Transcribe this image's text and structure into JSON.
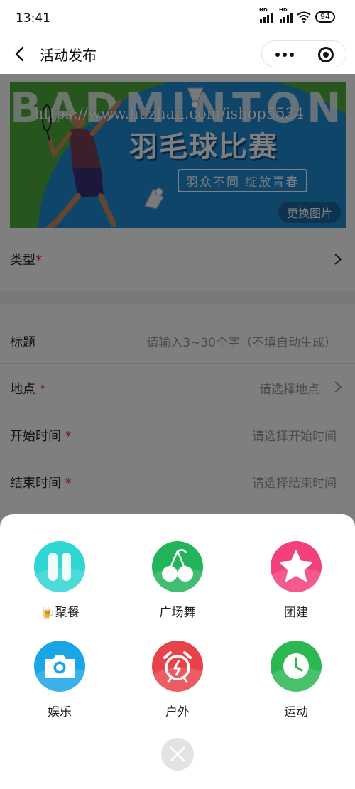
{
  "status_bar": {
    "time": "13:41",
    "battery": "94",
    "hd": "HD"
  },
  "nav": {
    "title": "活动发布"
  },
  "banner": {
    "bg_text": "BADMINTON",
    "url": "https://www.huzhan.com/ishop5534",
    "main_title": "羽毛球比赛",
    "subtitle": "羽众不同 绽放青春",
    "change_label": "更换图片"
  },
  "form": {
    "type_label": "类型",
    "required_mark": "*",
    "fields": [
      {
        "label": "标题",
        "placeholder": "请输入3~30个字（不填自动生成）",
        "required": false
      },
      {
        "label": "地点",
        "placeholder": "请选择地点",
        "required": true
      },
      {
        "label": "开始时间",
        "placeholder": "请选择开始时间",
        "required": true
      },
      {
        "label": "结束时间",
        "placeholder": "请选择结束时间",
        "required": true
      }
    ]
  },
  "categories": [
    {
      "label": "🍺聚餐",
      "icon": "pause-icon",
      "color": "#2fd6d3"
    },
    {
      "label": "广场舞",
      "icon": "cherry-icon",
      "color": "#22b45a"
    },
    {
      "label": "团建",
      "icon": "star-icon",
      "color": "#f2417a"
    },
    {
      "label": "娱乐",
      "icon": "camera-icon",
      "color": "#1aa6e6"
    },
    {
      "label": "户外",
      "icon": "alarm-clock-icon",
      "color": "#e8434a"
    },
    {
      "label": "运动",
      "icon": "clock-icon",
      "color": "#2cb752"
    }
  ],
  "colors": {
    "required": "#ee3333",
    "mask": "rgba(0,0,0,0.5)"
  }
}
